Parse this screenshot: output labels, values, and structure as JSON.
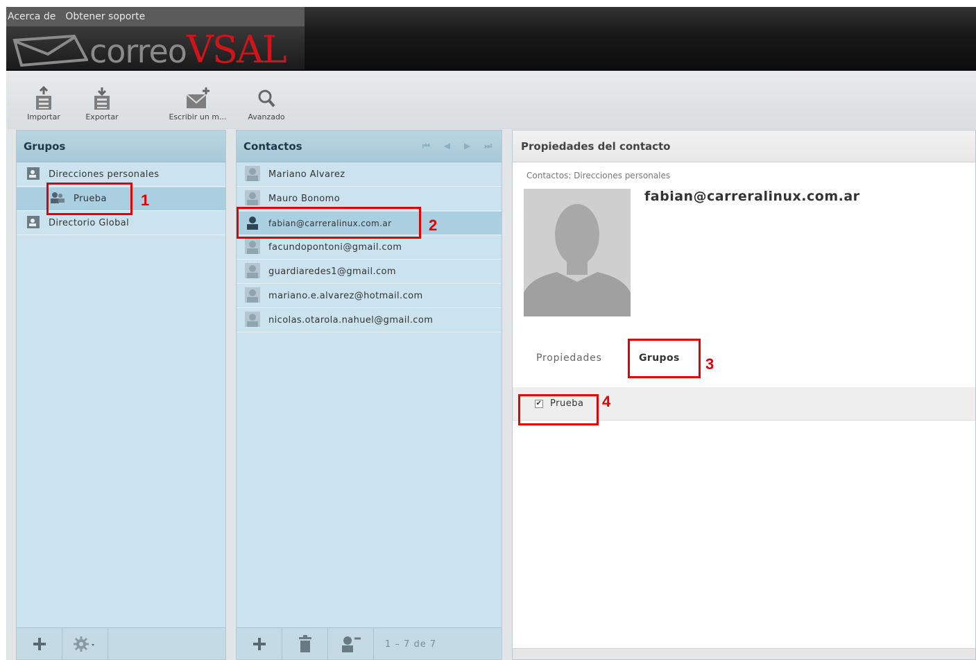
{
  "menu": {
    "about": "Acerca de",
    "support": "Obtener soporte"
  },
  "logo": {
    "prefix": "correo",
    "brand": "VSAL"
  },
  "toolbar": {
    "import": "Importar",
    "export": "Exportar",
    "compose": "Escribir un m...",
    "advanced": "Avanzado"
  },
  "groups": {
    "title": "Grupos",
    "items": [
      {
        "label": "Direcciones personales",
        "icon": "address-book-icon"
      },
      {
        "label": "Prueba",
        "icon": "group-icon"
      },
      {
        "label": "Directorio Global",
        "icon": "address-book-icon"
      }
    ]
  },
  "contacts": {
    "title": "Contactos",
    "items": [
      "Mariano Alvarez",
      "Mauro Bonomo",
      "fabian@carreralinux.com.ar",
      "facundopontoni@gmail.com",
      "guardiaredes1@gmail.com",
      "mariano.e.alvarez@hotmail.com",
      "nicolas.otarola.nahuel@gmail.com"
    ],
    "selected_index": 2,
    "pagination": "1 – 7 de 7"
  },
  "detail": {
    "title": "Propiedades del contacto",
    "breadcrumb": "Contactos: Direcciones personales",
    "name": "fabian@carreralinux.com.ar",
    "tabs": [
      "Propiedades",
      "Grupos"
    ],
    "active_tab": "Grupos",
    "group_checkbox_label": "Prueba",
    "group_checked": true
  },
  "annotations": [
    "1",
    "2",
    "3",
    "4"
  ],
  "colors": {
    "accent_red": "#e30000",
    "brand_red": "#d0141b",
    "panel_blue": "#cbe3ee"
  }
}
